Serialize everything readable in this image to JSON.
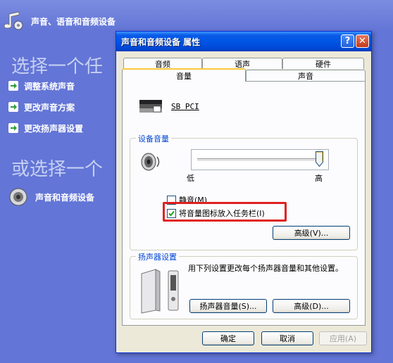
{
  "background": {
    "header_title": "声音、语音和音频设备",
    "heading_1": "选择一个任",
    "heading_2": "或选择一个",
    "tasks": [
      {
        "label": "调整系统声音"
      },
      {
        "label": "更改声音方案"
      },
      {
        "label": "更改扬声器设置"
      }
    ],
    "panel_item": "声音和音频设备"
  },
  "dialog": {
    "title": "声音和音频设备 属性",
    "help_glyph": "?",
    "close_glyph": "✕",
    "tabs_back": [
      "音频",
      "语声",
      "硬件"
    ],
    "tabs_front": [
      "音量",
      "声音"
    ],
    "active_tab": "音量",
    "device_name": "SB PCI",
    "device_volume": {
      "group_label": "设备音量",
      "low_label": "低",
      "high_label": "高",
      "level_percent": 100,
      "mute_label": "静音(M)",
      "mute_checked": false,
      "tray_label": "将音量图标放入任务栏(I)",
      "tray_checked": true,
      "advanced_button": "高级(V)..."
    },
    "speaker_settings": {
      "group_label": "扬声器设置",
      "description": "用下列设置更改每个扬声器音量和其他设置。",
      "speaker_volume_button": "扬声器音量(S)...",
      "advanced_button": "高级(D)..."
    },
    "buttons": {
      "ok": "确定",
      "cancel": "取消",
      "apply": "应用(A)"
    }
  },
  "colors": {
    "desktop": "#6375d6",
    "titlebar": "#0055e5",
    "highlight": "#e02020"
  },
  "icons": [
    "music-notes-icon",
    "arrow-right-icon",
    "speaker-icon",
    "sound-blaster-logo-icon",
    "desktop-speakers-icon",
    "checkmark-icon"
  ]
}
